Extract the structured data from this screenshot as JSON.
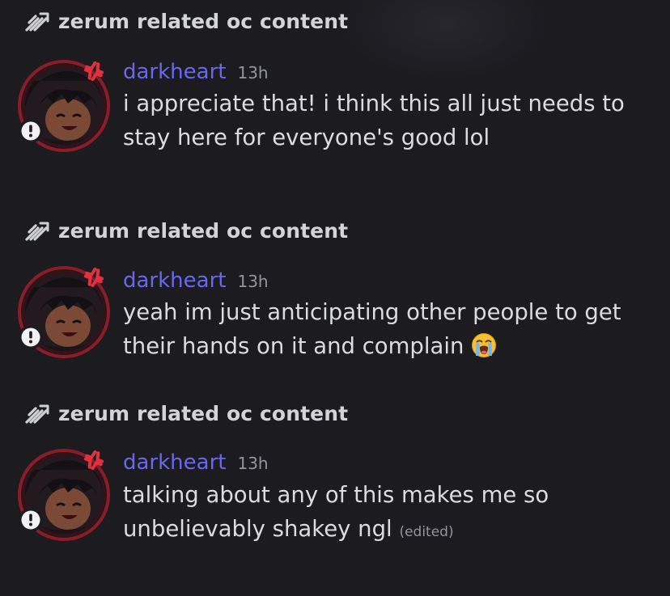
{
  "messages": [
    {
      "channel": "zerum related oc content",
      "author": "darkheart",
      "time": "13h",
      "lines": [
        "i appreciate that! i think this all just needs to",
        "stay here for everyone's good lol"
      ],
      "edited": "",
      "emoji": ""
    },
    {
      "channel": "zerum related oc content",
      "author": "darkheart",
      "time": "13h",
      "lines": [
        "yeah im just anticipating other people to get",
        "their hands on it and complain"
      ],
      "edited": "",
      "emoji": "loudly-crying-face-emoji"
    },
    {
      "channel": "zerum related oc content",
      "author": "darkheart",
      "time": "13h",
      "lines": [
        "talking about any of this makes me so",
        "unbelievably shakey ngl"
      ],
      "edited": "(edited)",
      "emoji": ""
    }
  ],
  "icons": {
    "channel": "thread-icon",
    "avatar_badge": "exclamation-icon"
  },
  "colors": {
    "background": "#1b1b20",
    "author": "#6a67ee",
    "text": "#dbdcdf",
    "muted": "#93959c",
    "avatar_ring": "#8c1d26"
  }
}
